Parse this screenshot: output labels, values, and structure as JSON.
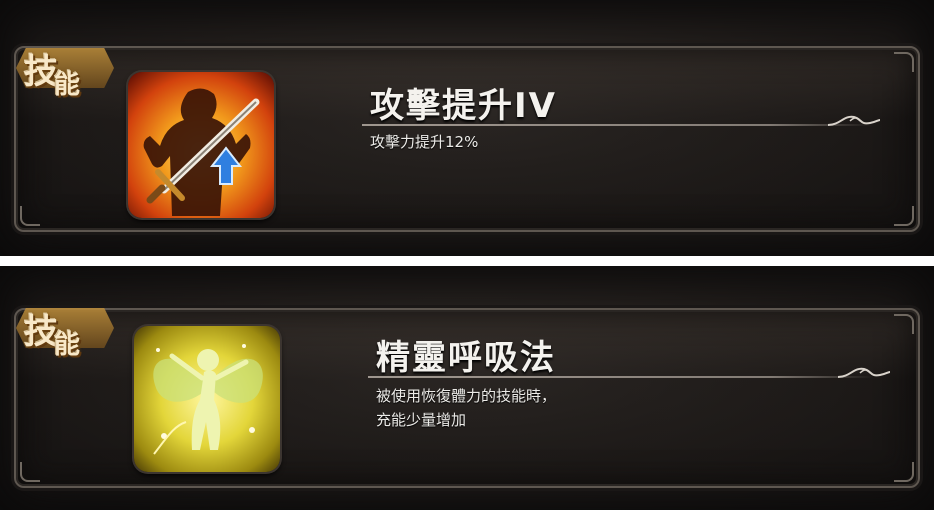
{
  "skills": [
    {
      "badge_main": "技",
      "badge_sub": "能",
      "icon": "attack-boost-icon",
      "title": "攻擊提升IV",
      "description_lines": [
        "攻擊力提升12%"
      ]
    },
    {
      "badge_main": "技",
      "badge_sub": "能",
      "icon": "fairy-spirit-icon",
      "title": "精靈呼吸法",
      "description_lines": [
        "被使用恢復體力的技能時，",
        "充能少量增加"
      ]
    }
  ],
  "colors": {
    "panel_bg": "#201c1a",
    "frame": "#5e5750",
    "badge_gold": "#b88a3a",
    "text": "#f4f2ee",
    "attack_icon_fire": "#e85a10",
    "fairy_icon_glow": "#e8e04a"
  }
}
